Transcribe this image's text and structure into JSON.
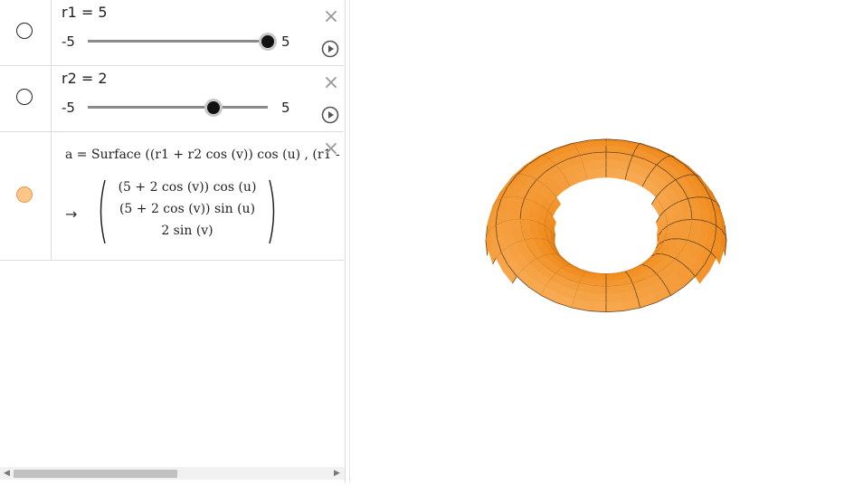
{
  "algebra": {
    "slider1": {
      "definition": "r1 = 5",
      "min": "-5",
      "max": "5",
      "value": 5,
      "min_value": -5,
      "max_value": 5
    },
    "slider2": {
      "definition": "r2 = 2",
      "min": "-5",
      "max": "5",
      "value": 2,
      "min_value": -5,
      "max_value": 5
    },
    "surface": {
      "input": "a = Surface ((r1 + r2  cos (v))  cos (u) , (r1 -",
      "arrow": "→",
      "result_rows": [
        "(5 + 2  cos (v))  cos (u)",
        "(5 + 2  cos (v))  sin (u)",
        "2  sin (v)"
      ]
    }
  },
  "colors": {
    "surface_fill": "#f08c1e",
    "surface_mesh": "#3a2a1a",
    "marble_fill": "#ffc68a",
    "slider_knob": "#111111"
  },
  "icons": {
    "delete": "close-icon",
    "animate": "play-icon"
  },
  "graphics": {
    "object": "torus",
    "major_radius": 5,
    "minor_radius": 2
  }
}
